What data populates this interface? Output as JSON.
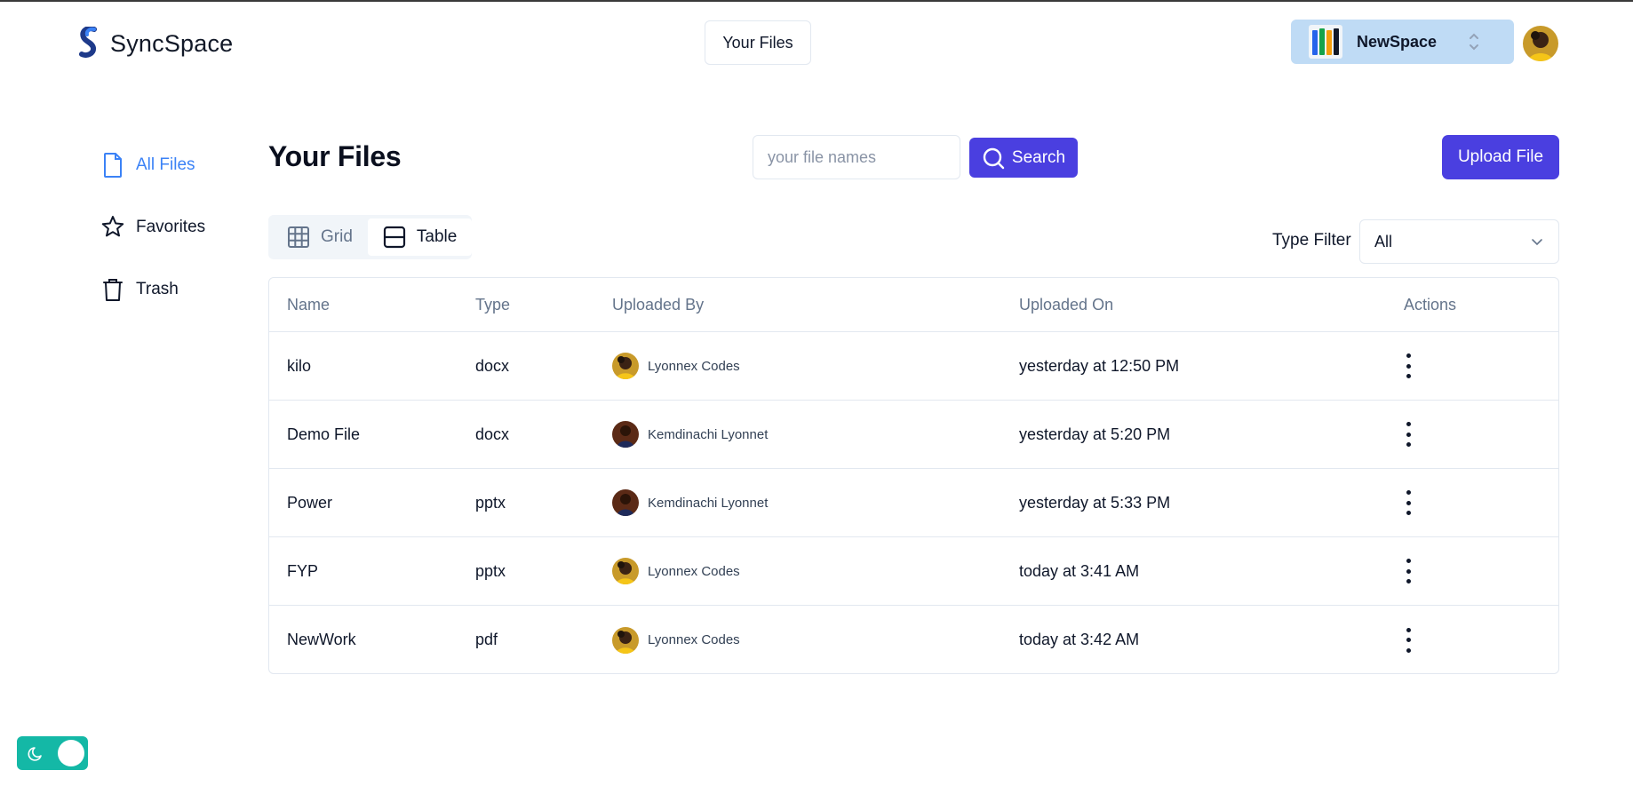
{
  "header": {
    "app_name": "SyncSpace",
    "nav_button_label": "Your Files",
    "workspace_name": "NewSpace"
  },
  "sidebar": {
    "items": [
      {
        "label": "All Files",
        "icon": "file-icon",
        "active": true
      },
      {
        "label": "Favorites",
        "icon": "star-icon",
        "active": false
      },
      {
        "label": "Trash",
        "icon": "trash-icon",
        "active": false
      }
    ]
  },
  "main": {
    "title": "Your Files",
    "search_placeholder": "your file names",
    "search_button_label": "Search",
    "upload_button_label": "Upload File",
    "view_toggle": [
      {
        "label": "Grid",
        "icon": "grid-icon",
        "active": false
      },
      {
        "label": "Table",
        "icon": "table-icon",
        "active": true
      }
    ],
    "type_filter_label": "Type Filter",
    "type_filter_value": "All"
  },
  "table": {
    "columns": [
      "Name",
      "Type",
      "Uploaded By",
      "Uploaded On",
      "Actions"
    ],
    "rows": [
      {
        "name": "kilo",
        "type": "docx",
        "uploaded_by": "Lyonnex Codes",
        "uploaded_on": "yesterday at 12:50 PM"
      },
      {
        "name": "Demo File",
        "type": "docx",
        "uploaded_by": "Kemdinachi Lyonnet",
        "uploaded_on": "yesterday at 5:20 PM"
      },
      {
        "name": "Power",
        "type": "pptx",
        "uploaded_by": "Kemdinachi Lyonnet",
        "uploaded_on": "yesterday at 5:33 PM"
      },
      {
        "name": "FYP",
        "type": "pptx",
        "uploaded_by": "Lyonnex Codes",
        "uploaded_on": "today at 3:41 AM"
      },
      {
        "name": "NewWork",
        "type": "pdf",
        "uploaded_by": "Lyonnex Codes",
        "uploaded_on": "today at 3:42 AM"
      }
    ]
  },
  "colors": {
    "primary": "#4a3fe0",
    "active_link": "#3b82f6",
    "workspace_bg": "#bfdbf5",
    "toggle_bg": "#14b8a6"
  }
}
